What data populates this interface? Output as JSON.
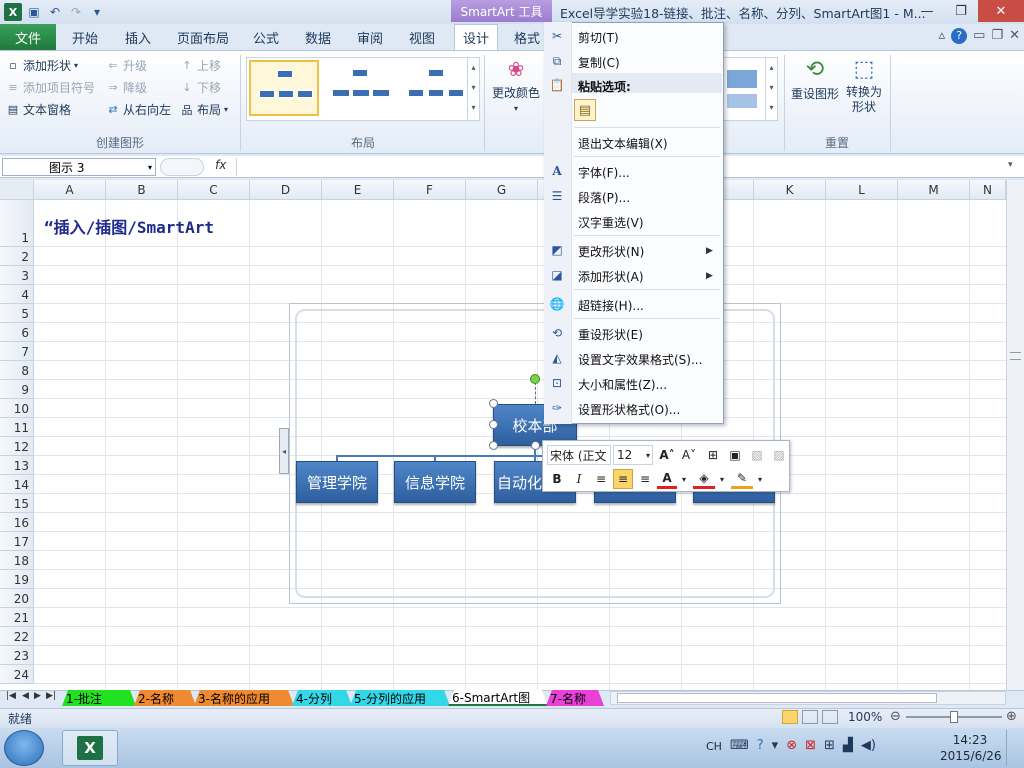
{
  "titlebar": {
    "context_tab": "SmartArt 工具",
    "window_title": "Excel导学实验18-链接、批注、名称、分列、SmartArt图1 - M..."
  },
  "tabs": {
    "file": "文件",
    "home": "开始",
    "insert": "插入",
    "page_layout": "页面布局",
    "formulas": "公式",
    "data": "数据",
    "review": "审阅",
    "view": "视图",
    "design": "设计",
    "format": "格式"
  },
  "ribbon": {
    "create_group": {
      "add_shape": "添加形状",
      "add_bullet": "添加项目符号",
      "text_pane": "文本窗格",
      "promote": "升级",
      "demote": "降级",
      "right_to_left": "从右向左",
      "move_up": "上移",
      "move_down": "下移",
      "layout": "布局",
      "label": "创建图形"
    },
    "layouts_label": "布局",
    "change_colors": "更改颜色",
    "reset_graphic": "重设图形",
    "convert_to_shapes": "转换为形状",
    "reset_label": "重置"
  },
  "formula_bar": {
    "name_box": "图示 3",
    "fx": "fx"
  },
  "columns": [
    "A",
    "B",
    "C",
    "D",
    "E",
    "F",
    "G",
    "H",
    "I",
    "J",
    "K",
    "L",
    "M",
    "N"
  ],
  "rows": [
    "1",
    "2",
    "3",
    "4",
    "5",
    "6",
    "7",
    "8",
    "9",
    "10",
    "11",
    "12",
    "13",
    "14",
    "15",
    "16",
    "17",
    "18",
    "19",
    "20",
    "21",
    "22",
    "23",
    "24"
  ],
  "cell_a1": "“插入/插图/SmartArt",
  "smartart": {
    "root": "校本部",
    "children": [
      "管理学院",
      "信息学院",
      "自动化",
      "",
      ""
    ]
  },
  "mini_toolbar": {
    "font": "宋体 (正文",
    "size": "12",
    "bold": "B",
    "italic": "I"
  },
  "context_menu": {
    "cut": "剪切(T)",
    "copy": "复制(C)",
    "paste_options": "粘贴选项:",
    "exit_text_edit": "退出文本编辑(X)",
    "font": "字体(F)...",
    "paragraph": "段落(P)...",
    "hanzi_reselect": "汉字重选(V)",
    "change_shape": "更改形状(N)",
    "add_shape": "添加形状(A)",
    "hyperlink": "超链接(H)...",
    "reset_shape": "重设形状(E)",
    "text_effects": "设置文字效果格式(S)...",
    "size_props": "大小和属性(Z)...",
    "shape_format": "设置形状格式(O)..."
  },
  "sheet_tabs": [
    {
      "label": "1-批注",
      "color": "#22e022"
    },
    {
      "label": "2-名称",
      "color": "#f08a30"
    },
    {
      "label": "3-名称的应用",
      "color": "#f08a30"
    },
    {
      "label": "4-分列",
      "color": "#33d8e8"
    },
    {
      "label": "5-分列的应用",
      "color": "#33d8e8"
    },
    {
      "label": "6-SmartArt图",
      "color": "#ffffff"
    },
    {
      "label": "7-名称",
      "color": "#e840d8"
    }
  ],
  "status": {
    "ready": "就绪",
    "zoom": "100%"
  },
  "taskbar": {
    "input": "CH",
    "time": "14:23",
    "date": "2015/6/26"
  },
  "colors": {
    "file_tab": "#1e7a3c",
    "smartart_context": "#9b7bcf",
    "node": "#3c6eb4"
  }
}
